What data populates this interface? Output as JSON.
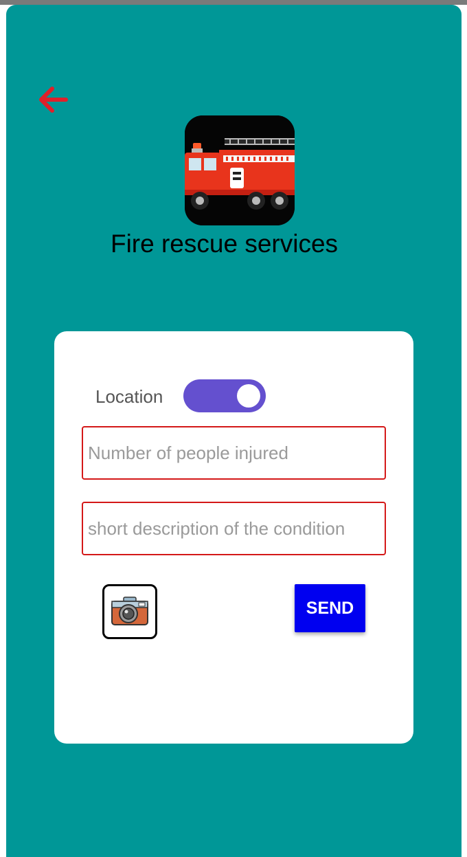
{
  "header": {
    "title": "Fire rescue services",
    "back_icon": "arrow-left-icon",
    "logo_icon": "fire-truck-icon"
  },
  "form": {
    "location_label": "Location",
    "location_toggle_on": true,
    "injured_placeholder": "Number of people injured",
    "description_placeholder": "short description of the condition",
    "camera_icon": "camera-icon",
    "send_label": "SEND"
  },
  "colors": {
    "background": "#009797",
    "card": "#ffffff",
    "toggle": "#6450cf",
    "field_border": "#d41818",
    "send_button": "#0000f0",
    "back_arrow": "#e0202a"
  }
}
